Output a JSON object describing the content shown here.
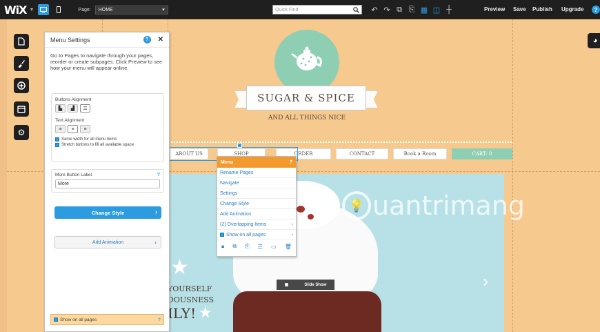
{
  "topbar": {
    "logo": "WiX",
    "page_label": "Page:",
    "page_value": "HOME",
    "quickfind_placeholder": "Quick Find",
    "preview": "Preview",
    "save": "Save",
    "publish": "Publish",
    "upgrade": "Upgrade",
    "help": "?"
  },
  "site": {
    "title": "SUGAR & SPICE",
    "tagline": "AND ALL THINGS NICE",
    "nav": [
      "ABOUT US",
      "SHOP",
      "ORDER",
      "CONTACT",
      "Book a Room",
      "CART: 0"
    ],
    "hero_lines": [
      "YOURSELF",
      "DOUSNESS",
      "ILY!"
    ],
    "slide_show": "Slide Show"
  },
  "watermark": "uantrimang",
  "panel": {
    "title": "Menu Settings",
    "description": "Go to Pages to navigate through your pages, reorder or create subpages. Click Preview to see how your menu will appear online.",
    "buttons_alignment_label": "Buttons Alignment",
    "text_alignment_label": "Text Alignment",
    "check_same_width": "Same width for all menu items",
    "check_stretch": "Stretch buttons to fill all available space",
    "more_label": "More Button Label",
    "more_help": "?",
    "more_value": "More",
    "change_style": "Change Style",
    "add_animation": "Add Animation",
    "show_all_pages": "Show on all pages",
    "footer_help": "?"
  },
  "context_menu": {
    "title": "Menu",
    "help": "?",
    "items": [
      "Rename Pages",
      "Navigate",
      "Settings",
      "Change Style",
      "Add Animation",
      "(2) Overlapping Items",
      "Show on all pages"
    ]
  },
  "colors": {
    "accent": "#2c9be0",
    "menu_header": "#f39a2e",
    "site_bg": "#f6c98e",
    "mint": "#8ecfb4"
  }
}
